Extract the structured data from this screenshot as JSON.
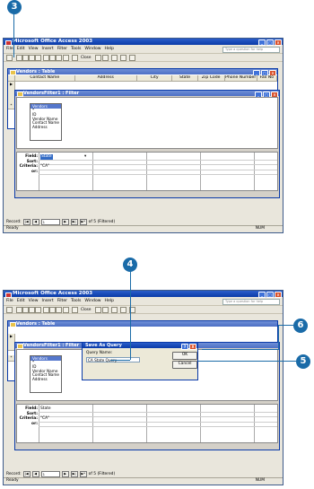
{
  "app": {
    "title": "Microsoft Office Access 2003",
    "menu": [
      "File",
      "Edit",
      "View",
      "Insert",
      "Filter",
      "Tools",
      "Window",
      "Help"
    ],
    "help_placeholder": "Type a question for help",
    "toolbar_close": "Close",
    "status_left": "Ready",
    "status_right": "NUM"
  },
  "table_window": {
    "title": "Vendors : Table",
    "columns": [
      "Contact Name",
      "Address",
      "City",
      "State",
      "Zip Code",
      "Phone Number",
      "Fax No"
    ],
    "row_marker": "▶",
    "new_marker": "*"
  },
  "filter_window": {
    "title": "VendorsFilter1 : Filter",
    "field_list": {
      "title": "Vendors",
      "items": [
        "*",
        "ID",
        "Vendor Name",
        "Contact Name",
        "Address"
      ]
    },
    "grid_labels": [
      "Field:",
      "Sort:",
      "Criteria:",
      "or:"
    ],
    "field_value": "State",
    "criteria_value": "\"CA\""
  },
  "record_bar": {
    "label": "Record:",
    "btn_first": "|◀",
    "btn_prev": "◀",
    "btn_next": "▶",
    "btn_last": "▶|",
    "btn_new": "▶*",
    "value": "1",
    "of_text": "of 5 (Filtered)"
  },
  "save_dialog": {
    "title": "Save As Query",
    "label": "Query Name:",
    "value": "CA State Query",
    "ok": "OK",
    "cancel": "Cancel",
    "help": "?",
    "close": "X"
  },
  "callouts": [
    "3",
    "4",
    "5",
    "6"
  ],
  "colors": {
    "callout": "#1a6ba8",
    "titlebar": "#0a3aa8",
    "chrome": "#e9e6dc"
  }
}
